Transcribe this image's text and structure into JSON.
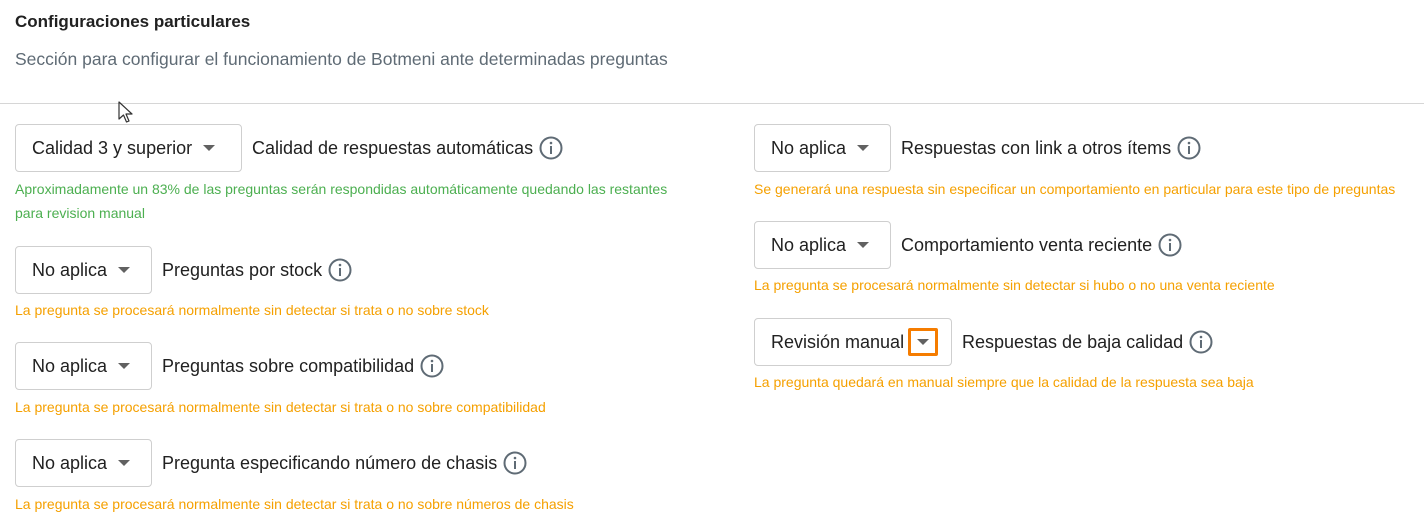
{
  "section": {
    "title": "Configuraciones particulares",
    "subtitle": "Sección para configurar el funcionamiento de Botmeni ante determinadas preguntas"
  },
  "left": [
    {
      "value": "Calidad 3 y superior",
      "label": "Calidad de respuestas automáticas",
      "hint_line1": "Aproximadamente un 83% de las preguntas serán respondidas automáticamente quedando las restantes",
      "hint_line2": "para revision manual",
      "hint_color": "#4caf50"
    },
    {
      "value": "No aplica",
      "label": "Preguntas por stock",
      "hint_line1": "La pregunta se procesará normalmente sin detectar si trata o no sobre stock",
      "hint_color": "#f5a000"
    },
    {
      "value": "No aplica",
      "label": "Preguntas sobre compatibilidad",
      "hint_line1": "La pregunta se procesará normalmente sin detectar si trata o no sobre compatibilidad",
      "hint_color": "#f5a000"
    },
    {
      "value": "No aplica",
      "label": "Pregunta especificando número de chasis",
      "hint_line1": "La pregunta se procesará normalmente sin detectar si trata o no sobre números de chasis",
      "hint_color": "#f5a000"
    }
  ],
  "right": [
    {
      "value": "No aplica",
      "label": "Respuestas con link a otros ítems",
      "hint_line1": "Se generará una respuesta sin especificar un comportamiento en particular para este tipo de preguntas",
      "hint_color": "#f5a000"
    },
    {
      "value": "No aplica",
      "label": "Comportamiento venta reciente",
      "hint_line1": "La pregunta se procesará normalmente sin detectar si hubo o no una venta reciente",
      "hint_color": "#f5a000"
    },
    {
      "value": "Revisión manual",
      "label": "Respuestas de baja calidad",
      "hint_line1": "La pregunta quedará en manual siempre que la calidad de la respuesta sea baja",
      "hint_color": "#f5a000"
    }
  ],
  "colors": {
    "highlight": "#f57c00",
    "icon": "#5f6b75",
    "border": "#cfcfcf"
  },
  "icons": {
    "info": "info-icon",
    "caret": "chevron-down-icon",
    "cursor": "mouse-pointer-icon"
  }
}
